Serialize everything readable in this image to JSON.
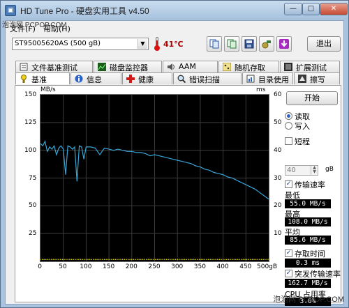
{
  "window": {
    "title": "HD Tune Pro - 硬盘实用工具 v4.50",
    "app_icon": "hdtune-app-icon"
  },
  "watermark": {
    "top": "泡泡网 PCPOP.COM",
    "bottom": "泡泡网 PCPOP.COM"
  },
  "caption_buttons": {
    "minimize": "—",
    "maximize": "□",
    "close": "✕"
  },
  "menu": [
    {
      "label": "文件(F)"
    },
    {
      "label": "帮助(H)"
    }
  ],
  "toolbar": {
    "drive": "ST95005620AS (500 gB)",
    "temperature": "41℃",
    "exit_label": "退出",
    "icons": [
      "copy-text-icon",
      "copy-info-icon",
      "save-icon",
      "options-icon",
      "screenshot-icon"
    ]
  },
  "tabs_top": [
    {
      "label": "文件基准测试",
      "icon": "file-benchmark-icon"
    },
    {
      "label": "磁盘监控器",
      "icon": "disk-monitor-icon"
    },
    {
      "label": "AAM",
      "icon": "speaker-icon"
    },
    {
      "label": "随机存取",
      "icon": "random-access-icon"
    },
    {
      "label": "扩展测试",
      "icon": "extra-tests-icon"
    }
  ],
  "tabs_bottom": [
    {
      "label": "基准",
      "icon": "benchmark-icon",
      "active": true
    },
    {
      "label": "信息",
      "icon": "info-icon"
    },
    {
      "label": "健康",
      "icon": "health-icon"
    },
    {
      "label": "错误扫描",
      "icon": "error-scan-icon"
    },
    {
      "label": "目录使用",
      "icon": "folder-usage-icon"
    },
    {
      "label": "擦写",
      "icon": "erase-icon"
    }
  ],
  "side_panel": {
    "start_label": "开始",
    "read_label": "读取",
    "write_label": "写入",
    "read_selected": true,
    "short_stroke_label": "短程",
    "short_stroke_checked": false,
    "short_stroke_value": "40",
    "short_stroke_unit": "gB",
    "transfer_rate_label": "传输速率",
    "transfer_rate_checked": true,
    "min_label": "最低",
    "min_value": "55.0 MB/s",
    "max_label": "最高",
    "max_value": "108.0 MB/s",
    "avg_label": "平均",
    "avg_value": "85.6 MB/s",
    "access_time_label": "存取时间",
    "access_time_checked": true,
    "access_time_value": "0.3 ms",
    "burst_rate_label": "突发传输速率",
    "burst_rate_checked": true,
    "burst_rate_value": "162.7 MB/s",
    "cpu_label": "CPU 占用率",
    "cpu_value": "3.0%"
  },
  "chart_data": {
    "type": "line",
    "x_unit": "gB",
    "y_left_unit": "MB/s",
    "y_right_unit": "ms",
    "x_ticks": [
      "0",
      "50",
      "100",
      "150",
      "200",
      "250",
      "300",
      "350",
      "400",
      "450",
      "500gB"
    ],
    "y_left_ticks": [
      "150",
      "125",
      "100",
      "75",
      "50",
      "25"
    ],
    "y_right_ticks": [
      "60",
      "50",
      "40",
      "30",
      "20",
      "10"
    ],
    "x_range": [
      0,
      500
    ],
    "y_left_range": [
      0,
      150
    ],
    "y_right_range": [
      0,
      60
    ],
    "colors": {
      "transfer": "#37a6d8",
      "access": "#d8c400",
      "background": "#000000",
      "grid": "#3c3c3c"
    },
    "series": [
      {
        "name": "传输速率",
        "x": [
          0,
          5,
          10,
          15,
          20,
          25,
          30,
          35,
          40,
          45,
          50,
          55,
          60,
          65,
          70,
          75,
          80,
          85,
          90,
          95,
          100,
          110,
          120,
          130,
          140,
          150,
          160,
          170,
          180,
          190,
          200,
          210,
          220,
          230,
          240,
          250,
          260,
          270,
          280,
          290,
          300,
          310,
          320,
          330,
          340,
          350,
          360,
          370,
          380,
          390,
          400,
          410,
          420,
          430,
          440,
          450,
          460,
          470,
          480,
          490,
          500
        ],
        "values": [
          106,
          104,
          108,
          99,
          103,
          101,
          104,
          96,
          102,
          104,
          101,
          78,
          104,
          103,
          101,
          103,
          72,
          104,
          103,
          92,
          103,
          103,
          102,
          96,
          102,
          101,
          100,
          101,
          100,
          99,
          99,
          98,
          98,
          97,
          95,
          96,
          95,
          94,
          93,
          92,
          91,
          90,
          89,
          88,
          86,
          85,
          83,
          82,
          80,
          79,
          78,
          76,
          75,
          73,
          71,
          69,
          67,
          65,
          62,
          59,
          56
        ]
      },
      {
        "name": "存取时间",
        "x": [
          0,
          100,
          200,
          300,
          400,
          500
        ],
        "values_ms": [
          0.3,
          0.3,
          0.3,
          0.3,
          0.3,
          0.3
        ]
      }
    ],
    "grid": true
  }
}
